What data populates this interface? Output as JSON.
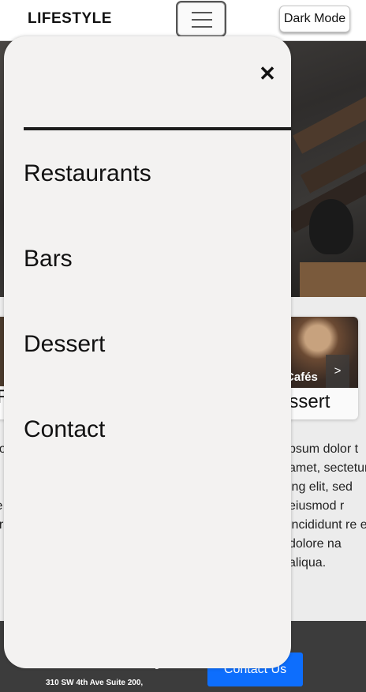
{
  "navbar": {
    "brand": "LIFESTYLE",
    "menu_icon": "hamburger-icon",
    "dark_mode_label": "Dark Mode"
  },
  "hero": {
    "image": "restaurant-photo"
  },
  "cards": {
    "left_title": "R",
    "right_caption": "Cafés",
    "right_next": ">",
    "right_title": "essert",
    "right_text": "psum dolor t amet, sectetur ing elit, sed eiusmod r incididunt re et dolore na aliqua.",
    "left_text": "Lo n c te ur"
  },
  "footer": {
    "address": "310 SW 4th Ave Suite 200,",
    "partial_heading": "y",
    "contact_label": "Contact Us"
  },
  "offcanvas": {
    "close_icon": "close-icon",
    "items": [
      {
        "label": "Restaurants"
      },
      {
        "label": "Bars"
      },
      {
        "label": "Dessert"
      },
      {
        "label": "Contact"
      }
    ]
  }
}
